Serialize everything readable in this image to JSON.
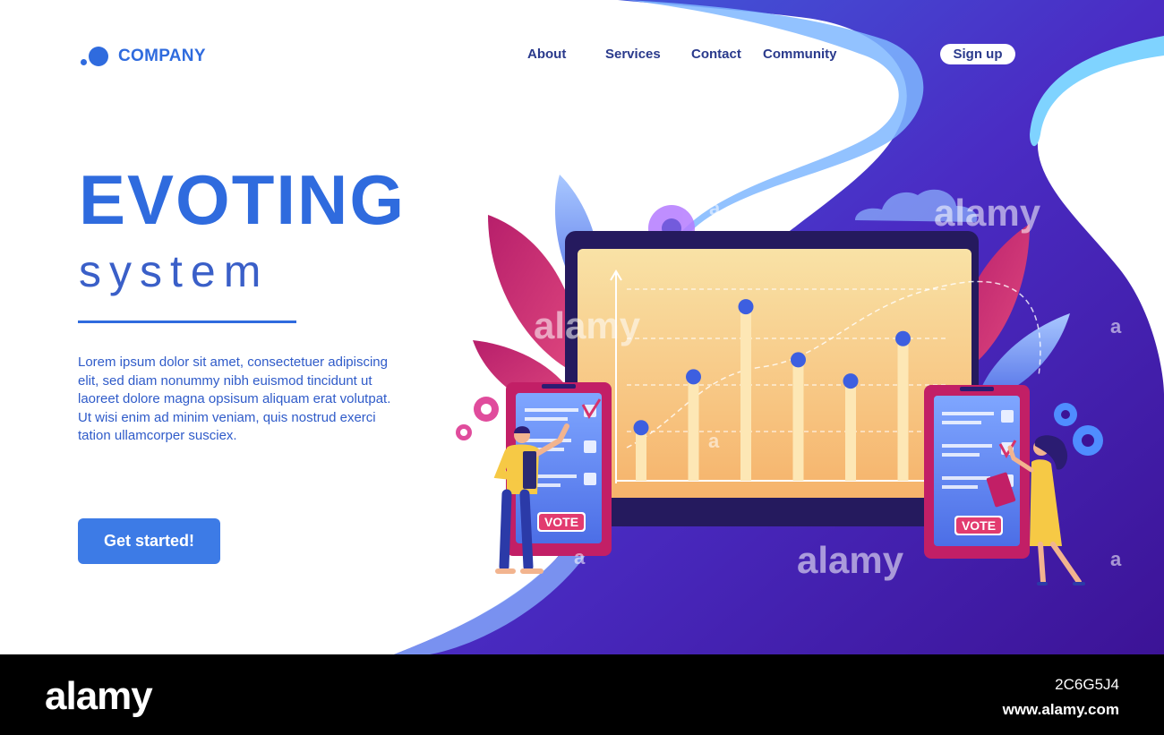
{
  "header": {
    "logo_text": "COMPANY",
    "nav": [
      {
        "label": "About"
      },
      {
        "label": "Services"
      },
      {
        "label": "Contact"
      },
      {
        "label": "Community"
      }
    ],
    "signup_label": "Sign up"
  },
  "hero": {
    "title": "EVOTING",
    "subtitle": "system",
    "body": "Lorem ipsum dolor sit amet, consectetuer adipiscing elit, sed diam nonummy nibh euismod tincidunt ut laoreet dolore magna opsisum aliquam erat volutpat. Ut wisi enim ad minim veniam, quis nostrud exerci tation ullamcorper susciex.",
    "cta_label": "Get started!"
  },
  "illustration": {
    "vote_label_left": "VOTE",
    "vote_label_right": "VOTE",
    "icons": [
      "laptop-icon",
      "phone-ballot-icon",
      "gear-icon",
      "leaf-icon",
      "cloud-icon",
      "checkmark-icon",
      "person-icon"
    ],
    "chart_levels": [
      0.25,
      0.49,
      0.82,
      0.57,
      0.47,
      0.67
    ]
  },
  "watermarks": [
    "alamy",
    "alamy",
    "alamy",
    "a",
    "a",
    "a",
    "a",
    "a",
    "a"
  ],
  "footer": {
    "brand": "alamy",
    "image_code": "2C6G5J4",
    "url": "www.alamy.com"
  },
  "colors": {
    "brand_blue": "#2f6bde",
    "nav_text": "#2a3a8c",
    "purple_deep": "#4a1aa0",
    "laptop_screen": "#fbd08a",
    "accent_pink": "#d6336c"
  }
}
